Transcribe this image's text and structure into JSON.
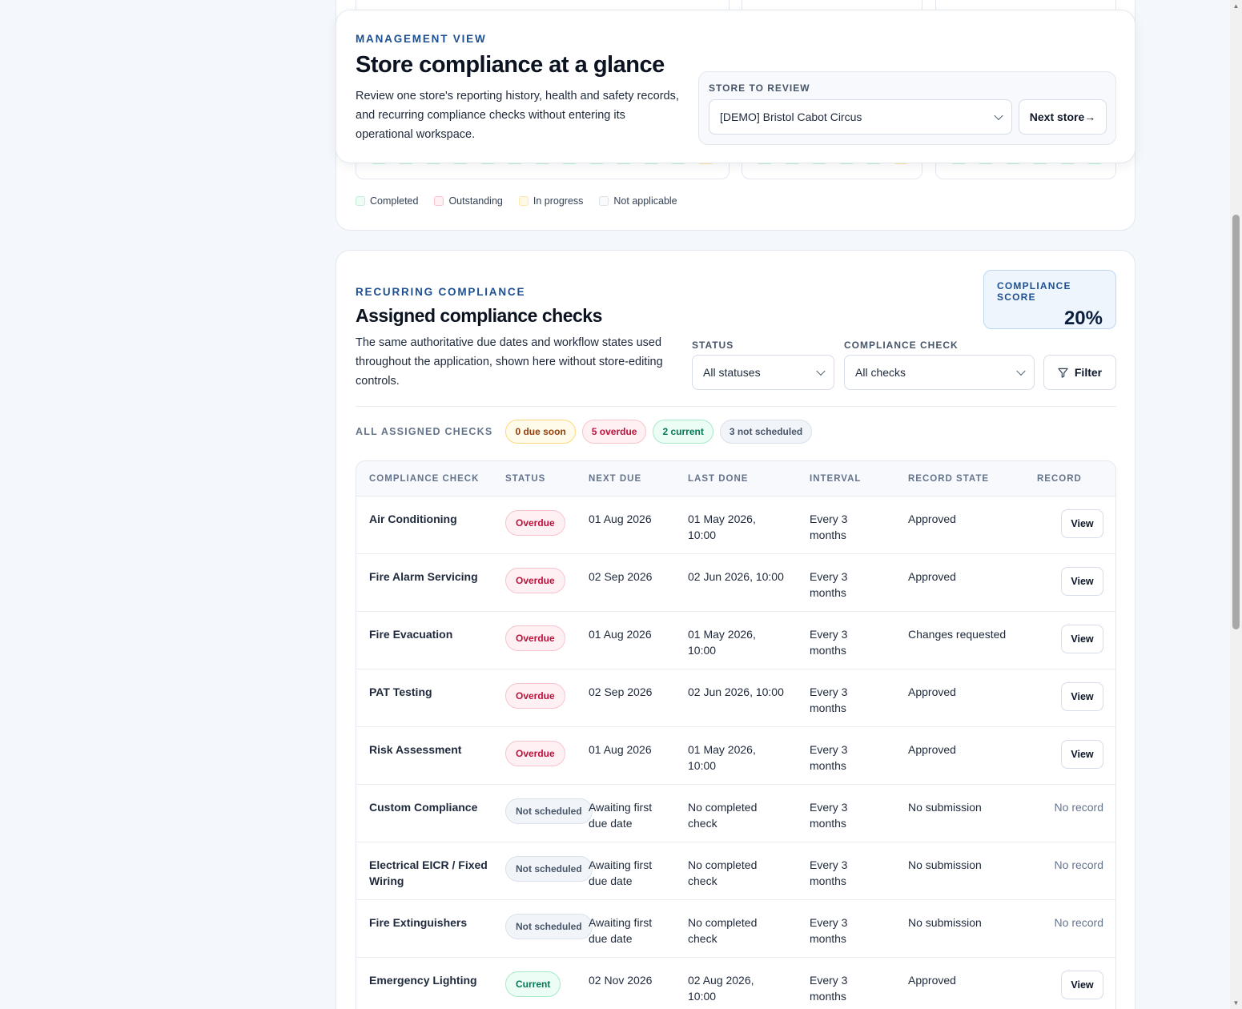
{
  "management": {
    "eyebrow": "MANAGEMENT VIEW",
    "title": "Store compliance at a glance",
    "description": "Review one store's reporting history, health and safety records, and recurring compliance checks without entering its operational workspace.",
    "store_label": "STORE TO REVIEW",
    "store_value": "[DEMO] Bristol Cabot Circus",
    "next_store_label": "Next store→"
  },
  "legend": [
    {
      "label": "Completed",
      "color": "#bff0d6"
    },
    {
      "label": "Outstanding",
      "color": "#f8c3cd"
    },
    {
      "label": "In progress",
      "color": "#fde7a6"
    },
    {
      "label": "Not applicable",
      "color": "#d9e1ea"
    }
  ],
  "recurring": {
    "eyebrow": "RECURRING COMPLIANCE",
    "title": "Assigned compliance checks",
    "description": "The same authoritative due dates and workflow states used throughout the application, shown here without store-editing controls.",
    "score_label": "COMPLIANCE SCORE",
    "score_value": "20%",
    "status_filter_label": "STATUS",
    "status_filter_value": "All statuses",
    "check_filter_label": "COMPLIANCE CHECK",
    "check_filter_value": "All checks",
    "filter_button": "Filter",
    "summary_label": "ALL ASSIGNED CHECKS",
    "summary_pills": {
      "due_soon": "0 due soon",
      "overdue": "5 overdue",
      "current": "2 current",
      "not_scheduled": "3 not scheduled"
    }
  },
  "table": {
    "headers": [
      "COMPLIANCE CHECK",
      "STATUS",
      "NEXT DUE",
      "LAST DONE",
      "INTERVAL",
      "RECORD STATE",
      "RECORD"
    ],
    "view_label": "View",
    "no_record_label": "No record",
    "rows": [
      {
        "name": "Air Conditioning",
        "status": "Overdue",
        "next_due": "01 Aug 2026",
        "last_done": "01 May 2026, 10:00",
        "interval": "Every 3 months",
        "record_state": "Approved",
        "has_record": true
      },
      {
        "name": "Fire Alarm Servicing",
        "status": "Overdue",
        "next_due": "02 Sep 2026",
        "last_done": "02 Jun 2026, 10:00",
        "interval": "Every 3 months",
        "record_state": "Approved",
        "has_record": true
      },
      {
        "name": "Fire Evacuation",
        "status": "Overdue",
        "next_due": "01 Aug 2026",
        "last_done": "01 May 2026, 10:00",
        "interval": "Every 3 months",
        "record_state": "Changes requested",
        "has_record": true
      },
      {
        "name": "PAT Testing",
        "status": "Overdue",
        "next_due": "02 Sep 2026",
        "last_done": "02 Jun 2026, 10:00",
        "interval": "Every 3 months",
        "record_state": "Approved",
        "has_record": true
      },
      {
        "name": "Risk Assessment",
        "status": "Overdue",
        "next_due": "01 Aug 2026",
        "last_done": "01 May 2026, 10:00",
        "interval": "Every 3 months",
        "record_state": "Approved",
        "has_record": true
      },
      {
        "name": "Custom Compliance",
        "status": "Not scheduled",
        "next_due": "Awaiting first due date",
        "last_done": "No completed check",
        "interval": "Every 3 months",
        "record_state": "No submission",
        "has_record": false
      },
      {
        "name": "Electrical EICR / Fixed Wiring",
        "status": "Not scheduled",
        "next_due": "Awaiting first due date",
        "last_done": "No completed check",
        "interval": "Every 3 months",
        "record_state": "No submission",
        "has_record": false
      },
      {
        "name": "Fire Extinguishers",
        "status": "Not scheduled",
        "next_due": "Awaiting first due date",
        "last_done": "No completed check",
        "interval": "Every 3 months",
        "record_state": "No submission",
        "has_record": false
      },
      {
        "name": "Emergency Lighting",
        "status": "Current",
        "next_due": "02 Nov 2026",
        "last_done": "02 Aug 2026, 10:00",
        "interval": "Every 3 months",
        "record_state": "Approved",
        "has_record": true
      }
    ]
  }
}
